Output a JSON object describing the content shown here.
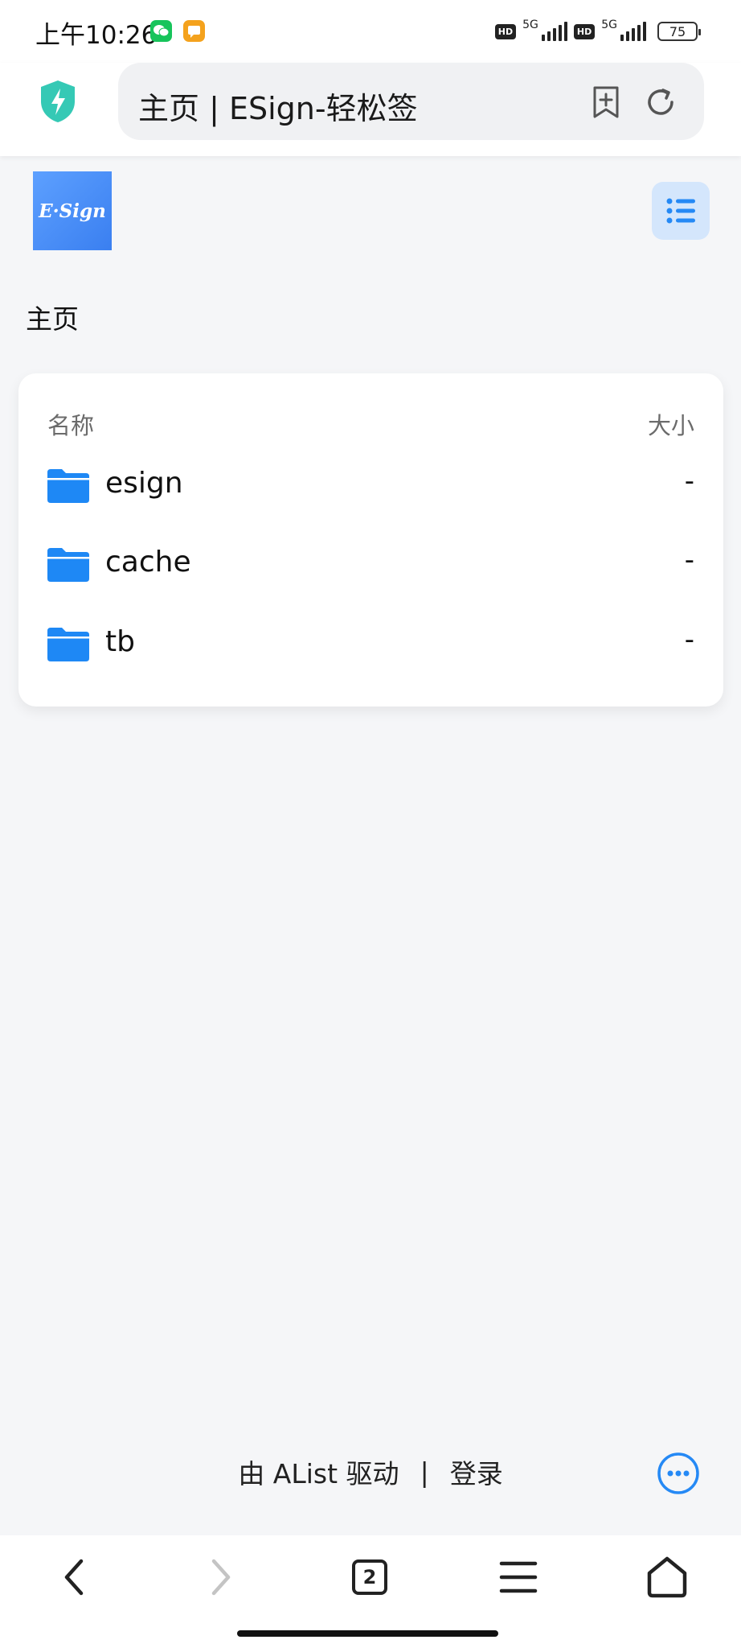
{
  "status_bar": {
    "time": "上午10:26",
    "network_1": "5G",
    "network_2": "5G",
    "hd_1": "HD",
    "hd_2": "HD",
    "battery": "75"
  },
  "browser": {
    "page_title": "主页 | ESign-轻松签",
    "tab_count": "2"
  },
  "site": {
    "logo_text": "E·Sign",
    "breadcrumb": "主页"
  },
  "file_list": {
    "header_name": "名称",
    "header_size": "大小",
    "items": [
      {
        "name": "esign",
        "size": "-"
      },
      {
        "name": "cache",
        "size": "-"
      },
      {
        "name": "tb",
        "size": "-"
      }
    ]
  },
  "footer": {
    "powered_by": "由 AList 驱动",
    "separator": "|",
    "login": "登录"
  },
  "colors": {
    "accent": "#2589f5",
    "folder": "#1e88f5",
    "page_bg": "#f5f6f8",
    "shield": "#35c9b5"
  }
}
